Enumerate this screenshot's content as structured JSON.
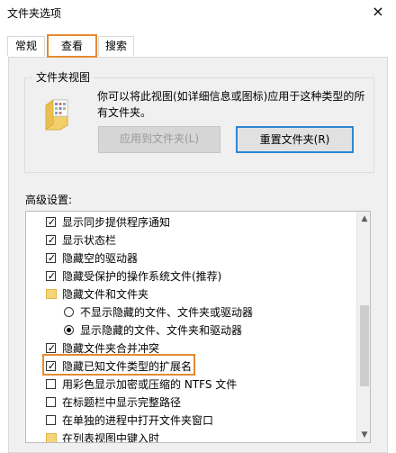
{
  "window": {
    "title": "文件夹选项",
    "close_glyph": "×"
  },
  "tabs": [
    {
      "label": "常规",
      "active": false
    },
    {
      "label": "查看",
      "active": true
    },
    {
      "label": "搜索",
      "active": false
    }
  ],
  "folder_views": {
    "legend": "文件夹视图",
    "description": "你可以将此视图(如详细信息或图标)应用于这种类型的所有文件夹。",
    "apply_button": "应用到文件夹(L)",
    "reset_button": "重置文件夹(R)"
  },
  "advanced": {
    "label": "高级设置:",
    "items": [
      {
        "type": "checkbox",
        "checked": true,
        "label": "显示同步提供程序通知"
      },
      {
        "type": "checkbox",
        "checked": true,
        "label": "显示状态栏"
      },
      {
        "type": "checkbox",
        "checked": true,
        "label": "隐藏空的驱动器"
      },
      {
        "type": "checkbox",
        "checked": true,
        "label": "隐藏受保护的操作系统文件(推荐)"
      },
      {
        "type": "folder",
        "label": "隐藏文件和文件夹"
      },
      {
        "type": "radio",
        "selected": false,
        "label": "不显示隐藏的文件、文件夹或驱动器"
      },
      {
        "type": "radio",
        "selected": true,
        "label": "显示隐藏的文件、文件夹和驱动器"
      },
      {
        "type": "checkbox",
        "checked": true,
        "label": "隐藏文件夹合并冲突"
      },
      {
        "type": "checkbox",
        "checked": true,
        "label": "隐藏已知文件类型的扩展名",
        "highlighted": true
      },
      {
        "type": "checkbox",
        "checked": false,
        "label": "用彩色显示加密或压缩的 NTFS 文件"
      },
      {
        "type": "checkbox",
        "checked": false,
        "label": "在标题栏中显示完整路径"
      },
      {
        "type": "checkbox",
        "checked": false,
        "label": "在单独的进程中打开文件夹窗口"
      },
      {
        "type": "folder",
        "label": "在列表视图中键入时"
      }
    ]
  },
  "scrollbar": {
    "up_glyph": "▲",
    "down_glyph": "▼"
  },
  "colors": {
    "highlight": "#e48a32",
    "default_button_border": "#2d86d3",
    "panel": "#f0f0f0"
  },
  "icons": {
    "close": "close-icon",
    "folder": "folder-icon"
  }
}
